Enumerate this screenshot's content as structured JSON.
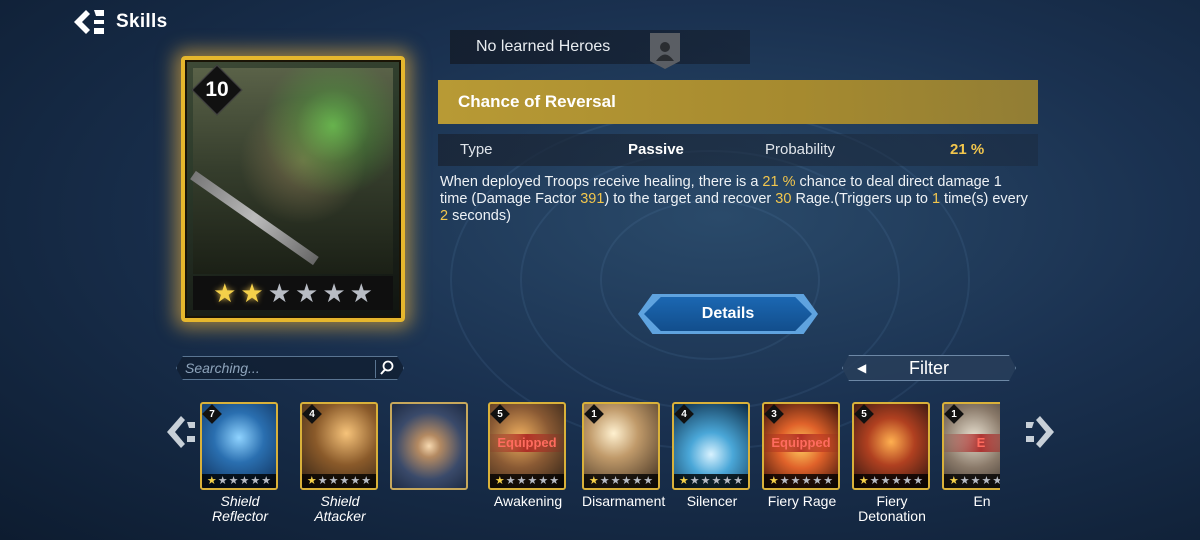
{
  "header": {
    "title": "Skills",
    "back_icon": "back-arrow-icon"
  },
  "hero": {
    "level": "10",
    "stars_filled": 2,
    "stars_total": 6
  },
  "learned": {
    "text": "No learned Heroes",
    "avatar_icon": "hero-silhouette-icon"
  },
  "skill": {
    "title": "Chance of Reversal",
    "type_label": "Type",
    "type_value": "Passive",
    "probability_label": "Probability",
    "probability_value": "21 %",
    "description": {
      "p1": "When deployed Troops receive healing, there is a ",
      "v1": "21 %",
      "p2": " chance to deal direct damage 1 time (Damage Factor ",
      "v2": "391",
      "p3": ") to the target and recover ",
      "v3": "30",
      "p4": " Rage.(Triggers up to ",
      "v4": "1",
      "p5": " time(s) every ",
      "v5": "2",
      "p6": " seconds)"
    }
  },
  "details_button": {
    "label": "Details"
  },
  "search": {
    "placeholder": "Searching..."
  },
  "filter": {
    "label": "Filter"
  },
  "skill_list": [
    {
      "name": "Shield Reflector",
      "level": "7",
      "equipped": false,
      "italic": true
    },
    {
      "name": "Shield Attacker",
      "level": "4",
      "equipped": false,
      "italic": true
    },
    {
      "name": "",
      "level": "",
      "equipped": false,
      "italic": false
    },
    {
      "name": "Awakening",
      "level": "5",
      "equipped": true,
      "equipped_label": "Equipped",
      "italic": false
    },
    {
      "name": "Disarmament",
      "level": "1",
      "equipped": false,
      "italic": false
    },
    {
      "name": "Silencer",
      "level": "4",
      "equipped": false,
      "italic": false
    },
    {
      "name": "Fiery Rage",
      "level": "3",
      "equipped": true,
      "equipped_label": "Equipped",
      "italic": false
    },
    {
      "name": "Fiery Detonation",
      "level": "5",
      "equipped": false,
      "italic": false
    },
    {
      "name": "En",
      "level": "1",
      "equipped": true,
      "equipped_label": "E",
      "italic": false
    }
  ],
  "colors": {
    "gold": "#e6b72d",
    "highlight": "#f2c64d",
    "accent_blue": "#1b67b2"
  }
}
